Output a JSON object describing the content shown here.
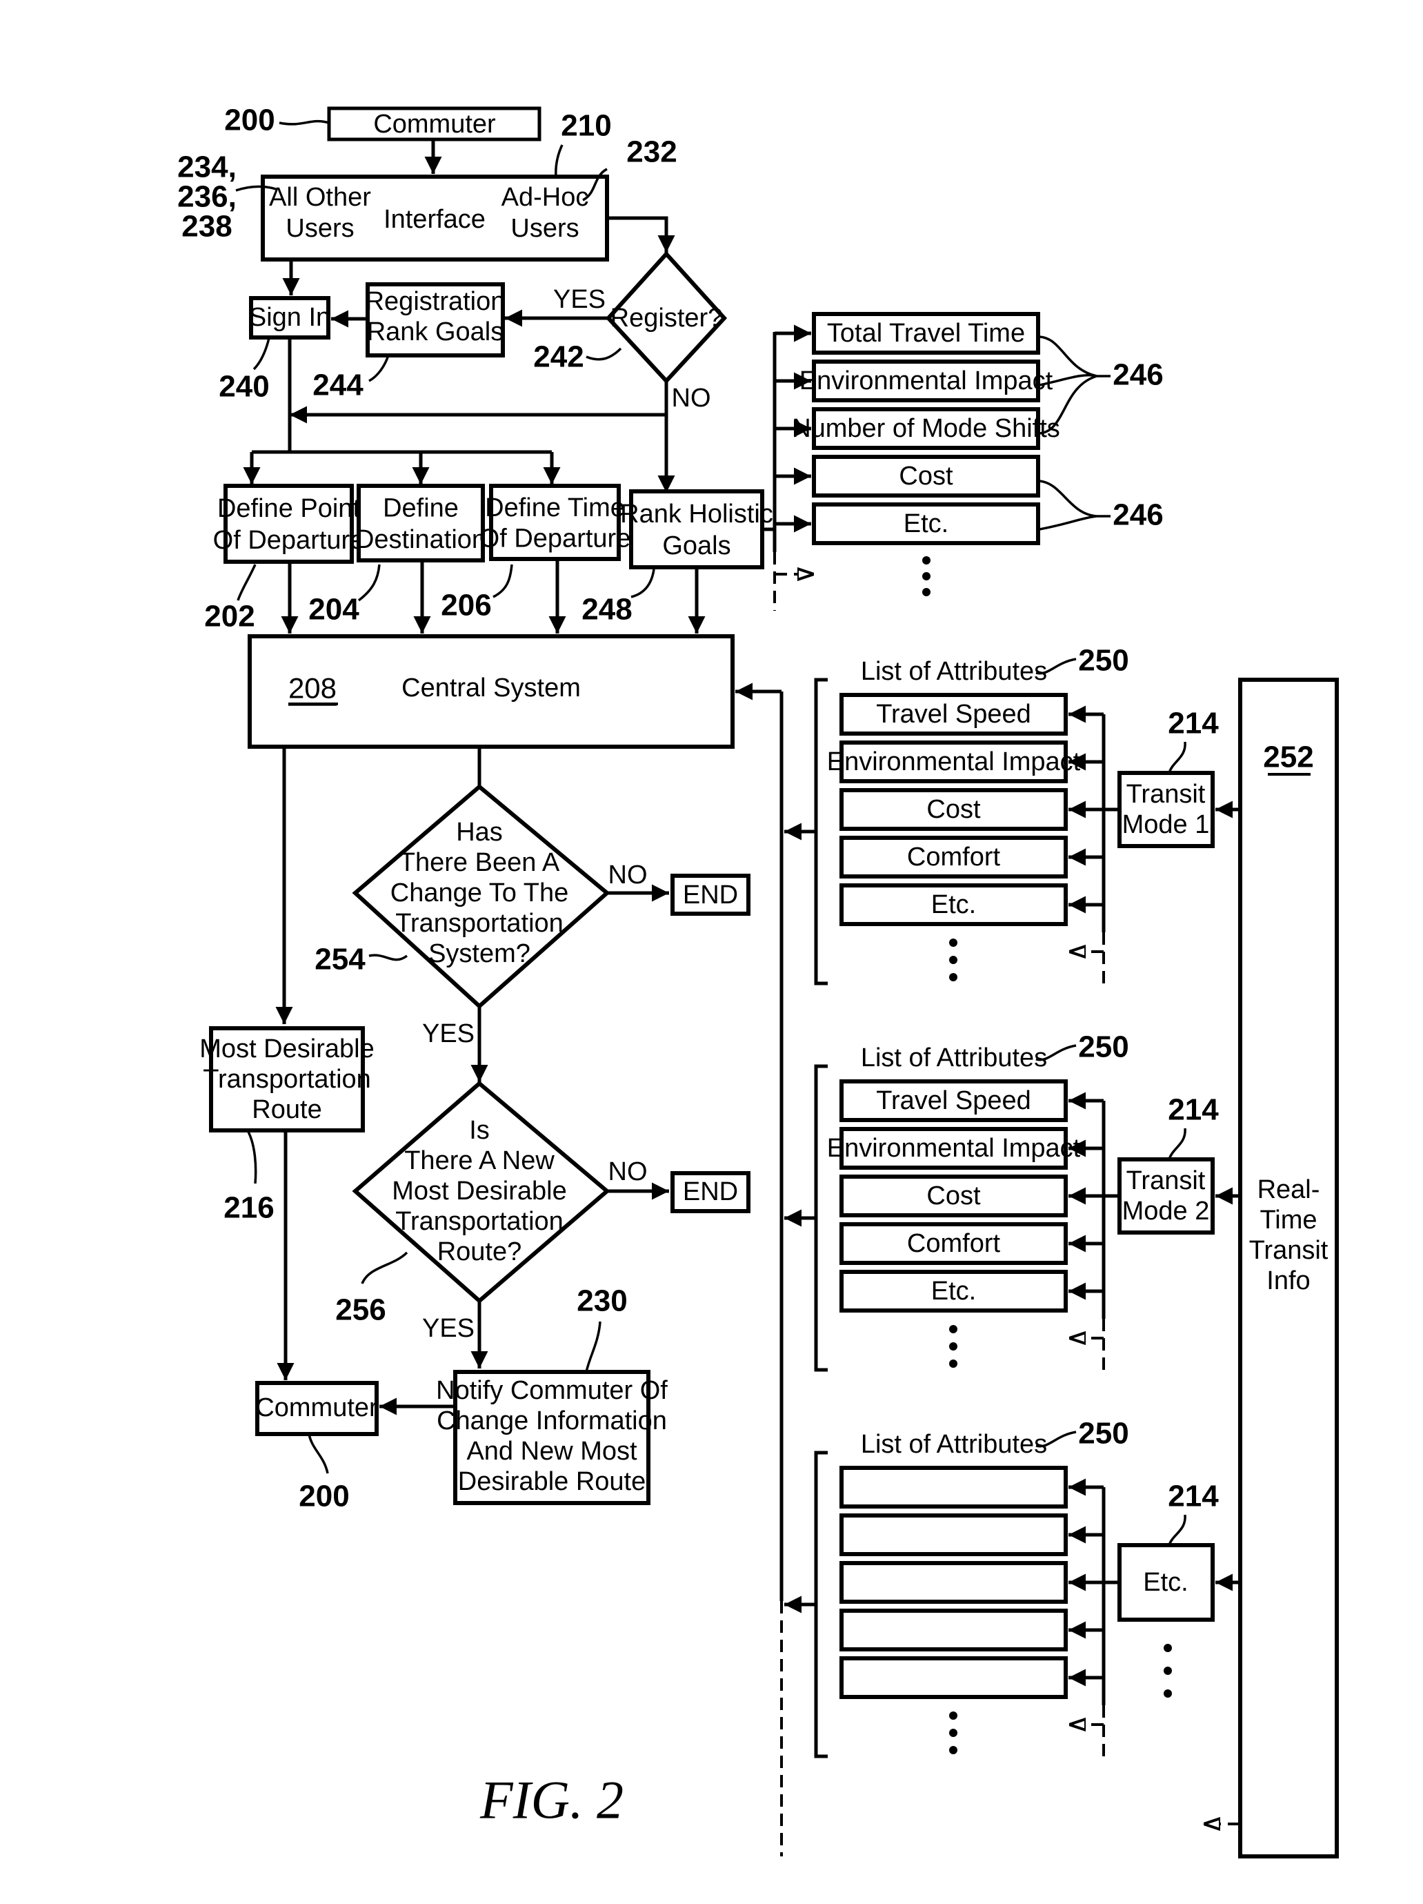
{
  "figure": {
    "caption": "FIG.  2",
    "colors": {
      "ink": "#000000",
      "paper": "#ffffff"
    }
  },
  "top": {
    "commuter": {
      "label": "Commuter",
      "ref": "200"
    },
    "interface": {
      "ref": "210",
      "center_label": "Interface",
      "left_label": [
        "All Other",
        "Users"
      ],
      "left_ref": [
        "234,",
        "236,",
        "238"
      ],
      "right_label": [
        "Ad-Hoc",
        "Users"
      ],
      "right_ref": "232"
    },
    "sign_in": {
      "label": "Sign In",
      "ref": "240"
    },
    "registration": {
      "label": [
        "Registration",
        "Rank Goals"
      ],
      "ref": "244"
    },
    "register_decision": {
      "label": "Register?",
      "ref": "242",
      "yes": "YES",
      "no": "NO"
    }
  },
  "define_row": [
    {
      "label": [
        "Define Point",
        "Of Departure"
      ],
      "ref": "202"
    },
    {
      "label": [
        "Define",
        "Destination"
      ],
      "ref": "204"
    },
    {
      "label": [
        "Define Time",
        "Of Departure"
      ],
      "ref": "206"
    },
    {
      "label": [
        "Rank Holistic",
        "Goals"
      ],
      "ref": "248"
    }
  ],
  "holistic_goals": {
    "items": [
      "Total Travel Time",
      "Environmental Impact",
      "Number of Mode Shifts",
      "Cost",
      "Etc."
    ],
    "refs": [
      "246",
      "246"
    ]
  },
  "central_system": {
    "ref": "208",
    "label": "Central System"
  },
  "decision_change": {
    "ref": "254",
    "label": [
      "Has",
      "There Been A",
      "Change To The",
      "Transportation",
      "System?"
    ],
    "no": "NO",
    "yes": "YES",
    "end": "END"
  },
  "decision_new_route": {
    "ref": "256",
    "label": [
      "Is",
      "There A New",
      "Most Desirable",
      "Transportation",
      "Route?"
    ],
    "no": "NO",
    "yes": "YES",
    "end": "END"
  },
  "most_desirable": {
    "label": [
      "Most Desirable",
      "Transportation",
      "Route"
    ],
    "ref": "216"
  },
  "commuter_bottom": {
    "label": "Commuter",
    "ref": "200"
  },
  "notify": {
    "label": [
      "Notify Commuter Of",
      "Change Information",
      "And New Most",
      "Desirable Route"
    ],
    "ref": "230"
  },
  "attribute_lists": [
    {
      "title": "List of Attributes",
      "ref": "250",
      "items": [
        "Travel Speed",
        "Environmental Impact",
        "Cost",
        "Comfort",
        "Etc."
      ],
      "mode": {
        "label": [
          "Transit",
          "Mode 1"
        ],
        "ref": "214"
      }
    },
    {
      "title": "List of Attributes",
      "ref": "250",
      "items": [
        "Travel Speed",
        "Environmental Impact",
        "Cost",
        "Comfort",
        "Etc."
      ],
      "mode": {
        "label": [
          "Transit",
          "Mode 2"
        ],
        "ref": "214"
      }
    },
    {
      "title": "List of Attributes",
      "ref": "250",
      "items": [
        "",
        "",
        "",
        "",
        ""
      ],
      "mode": {
        "label": [
          "Etc."
        ],
        "ref": "214"
      }
    }
  ],
  "realtime": {
    "ref": "252",
    "label": [
      "Real-",
      "Time",
      "Transit",
      "Info"
    ]
  }
}
